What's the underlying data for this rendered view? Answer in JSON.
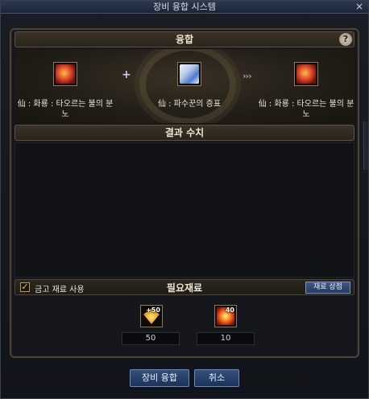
{
  "window": {
    "title": "장비 융합 시스템",
    "close_label": "×"
  },
  "fusion": {
    "header": "융합",
    "help_label": "?",
    "plus": "+",
    "arrow": "›››",
    "items": [
      {
        "name": "仙 : 화룡 : 타오르는 불의 분노",
        "icon": "fire-dragon-icon"
      },
      {
        "name": "仙 : 파수꾼의 증표",
        "icon": "guardian-certificate-icon"
      },
      {
        "name": "仙 : 화룡 : 타오르는 불의 분노",
        "icon": "fire-dragon-icon"
      }
    ]
  },
  "result": {
    "header": "결과 수치"
  },
  "materials": {
    "use_gold_checked": true,
    "use_gold_label": "금고 재료 사용",
    "title": "필요재료",
    "shop_button": "재료 상점",
    "items": [
      {
        "badge": "+50",
        "quantity": "50",
        "icon": "gold-gem-icon"
      },
      {
        "badge": "40",
        "quantity": "10",
        "icon": "fire-burst-icon"
      }
    ]
  },
  "buttons": {
    "fuse": "장비 융합",
    "cancel": "취소"
  }
}
